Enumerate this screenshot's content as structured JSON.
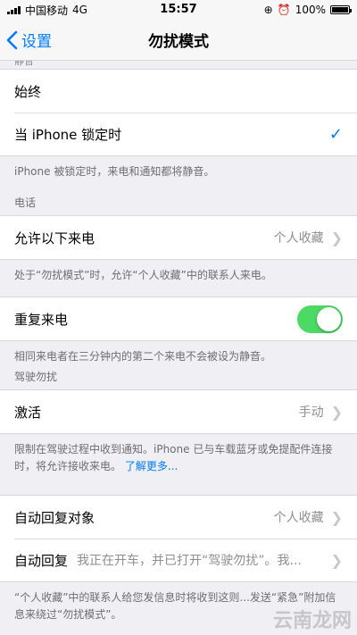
{
  "status_bar": {
    "carrier": "中国移动",
    "network": "4G",
    "time": "15:57",
    "battery_percent": "100%",
    "battery_level": 1.0
  },
  "nav": {
    "back_label": "设置",
    "title": "勿扰模式"
  },
  "silence_section": {
    "header_partial": "静音",
    "options": [
      {
        "label": "始终"
      },
      {
        "label": "当 iPhone 锁定时"
      }
    ],
    "footer": "iPhone 被锁定时，来电和通知都将静音。"
  },
  "phone_section": {
    "header": "电话",
    "allow_calls_label": "允许以下来电",
    "allow_calls_value": "个人收藏",
    "allow_calls_footer": "处于“勿扰模式”时，允许“个人收藏”中的联系人来电。",
    "repeated_calls_label": "重复来电",
    "repeated_calls_on": true,
    "repeated_calls_footer": "相同来电者在三分钟内的第二个来电不会被设为静音。"
  },
  "driving_section": {
    "header": "驾驶勿扰",
    "activate_label": "激活",
    "activate_value": "手动",
    "footer": "限制在驾驶过程中收到通知。iPhone 已与车载蓝牙或免提配件连接时，将允许接收来电。",
    "learn_more": "了解更多...",
    "auto_reply_to_label": "自动回复对象",
    "auto_reply_to_value": "个人收藏",
    "auto_reply_label": "自动回复",
    "auto_reply_value": "我正在开车，并已打开“驾驶勿扰”。我...",
    "bottom_footer": "“个人收藏”中的联系人给您发信息时将收到这则...发送“紧急”附加信息来绕过“勿扰模式”。"
  },
  "watermark": "云南龙网",
  "colors": {
    "accent": "#007aff",
    "toggle_on": "#4cd964",
    "background": "#efeff4"
  }
}
